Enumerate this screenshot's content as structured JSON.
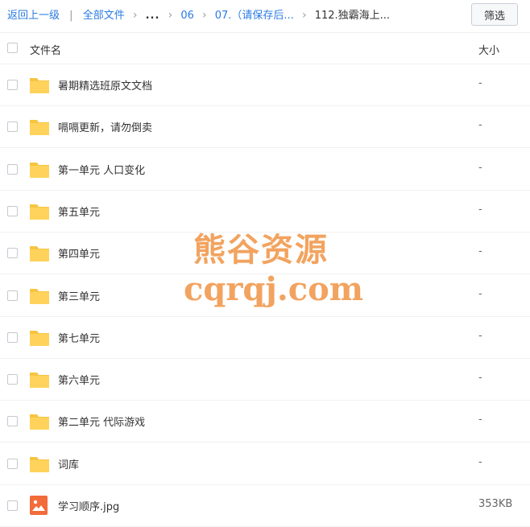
{
  "breadcrumb": {
    "back": "返回上一级",
    "separator": "|",
    "all_files": "全部文件",
    "ellipsis": "...",
    "items": [
      "06",
      "07.（请保存后...",
      "112.独霸海上..."
    ]
  },
  "toolbar": {
    "filter_label": "筛选"
  },
  "table": {
    "col_name": "文件名",
    "col_size": "大小",
    "rows": [
      {
        "name": "暑期精选班原文文档",
        "size": "-",
        "icon": "folder-icon"
      },
      {
        "name": "嗝嗝更新，请勿倒卖",
        "size": "-",
        "icon": "folder-icon"
      },
      {
        "name": "第一单元 人口变化",
        "size": "-",
        "icon": "folder-icon"
      },
      {
        "name": "第五单元",
        "size": "-",
        "icon": "folder-icon"
      },
      {
        "name": "第四单元",
        "size": "-",
        "icon": "folder-icon"
      },
      {
        "name": "第三单元",
        "size": "-",
        "icon": "folder-icon"
      },
      {
        "name": "第七单元",
        "size": "-",
        "icon": "folder-icon"
      },
      {
        "name": "第六单元",
        "size": "-",
        "icon": "folder-icon"
      },
      {
        "name": "第二单元 代际游戏",
        "size": "-",
        "icon": "folder-icon"
      },
      {
        "name": "词库",
        "size": "-",
        "icon": "folder-icon"
      },
      {
        "name": "学习顺序.jpg",
        "size": "353KB",
        "icon": "image-file-icon"
      }
    ]
  },
  "watermark": {
    "line1": "熊谷资源",
    "line2": "cqrqj.com"
  },
  "colors": {
    "link": "#2a7ae2",
    "folder": "#ffd35b",
    "image_icon": "#f26b3a",
    "watermark": "#f2a35f"
  }
}
